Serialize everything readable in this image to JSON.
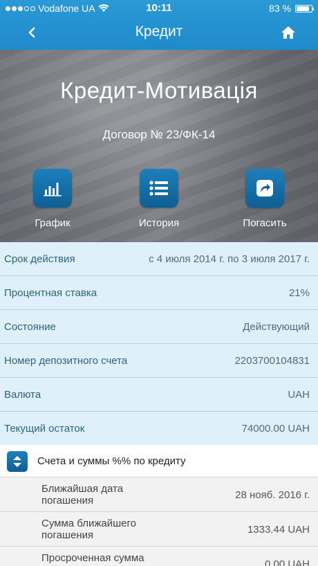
{
  "status_bar": {
    "carrier": "Vodafone UA",
    "time": "10:11",
    "battery": "83 %"
  },
  "nav": {
    "title": "Кредит",
    "back_icon": "chevron-left-icon",
    "home_icon": "home-icon"
  },
  "hero": {
    "product_name": "Кредит-Мотивація",
    "contract": "Договор № 23/ФК-14",
    "actions": [
      {
        "label": "График",
        "icon": "bar-chart-icon"
      },
      {
        "label": "История",
        "icon": "list-icon"
      },
      {
        "label": "Погасить",
        "icon": "share-arrow-icon"
      }
    ]
  },
  "details": [
    {
      "label": "Срок действия",
      "value": "с 4 июля 2014 г. по 3 июля 2017 г."
    },
    {
      "label": "Процентная ставка",
      "value": "21%"
    },
    {
      "label": "Состояние",
      "value": "Действующий"
    },
    {
      "label": "Номер депозитного счета",
      "value": "2203700104831"
    },
    {
      "label": "Валюта",
      "value": "UAH"
    },
    {
      "label": "Текущий остаток",
      "value": "74000.00 UAH"
    }
  ],
  "section": {
    "title": "Счета и суммы %% по кредиту",
    "toggle_icon": "expand-collapse-icon"
  },
  "sub_details": [
    {
      "label": "Ближайшая дата погашения",
      "value": "28 нояб. 2016 г."
    },
    {
      "label": "Сумма ближайшего погашения",
      "value": "1333.44 UAH"
    },
    {
      "label": "Просроченная сумма",
      "value": "0.00 UAH"
    }
  ],
  "colors": {
    "nav_blue": "#1f8acb",
    "button_blue": "#0e5f94",
    "row_bg": "#dff0fb",
    "label_blue": "#2a6384"
  }
}
